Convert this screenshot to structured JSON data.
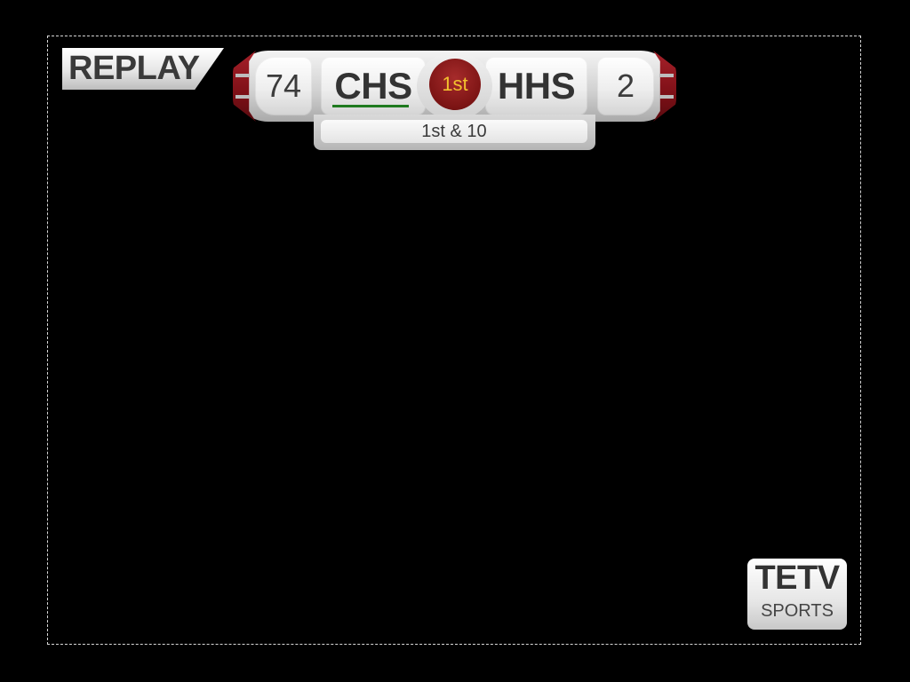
{
  "replay_tag": {
    "label": "REPLAY"
  },
  "scoreboard": {
    "home": {
      "score": "74",
      "team": "CHS",
      "has_possession": true
    },
    "away": {
      "team": "HHS",
      "score": "2"
    },
    "period": "1st",
    "down_distance": "1st & 10"
  },
  "logo": {
    "title": "TETV",
    "subtitle": "SPORTS"
  },
  "colors": {
    "background": "#000000",
    "accent_red": "#7c1414",
    "period_text": "#f2c12e",
    "possession_indicator": "#1f7a1f",
    "panel_text": "#333333"
  }
}
